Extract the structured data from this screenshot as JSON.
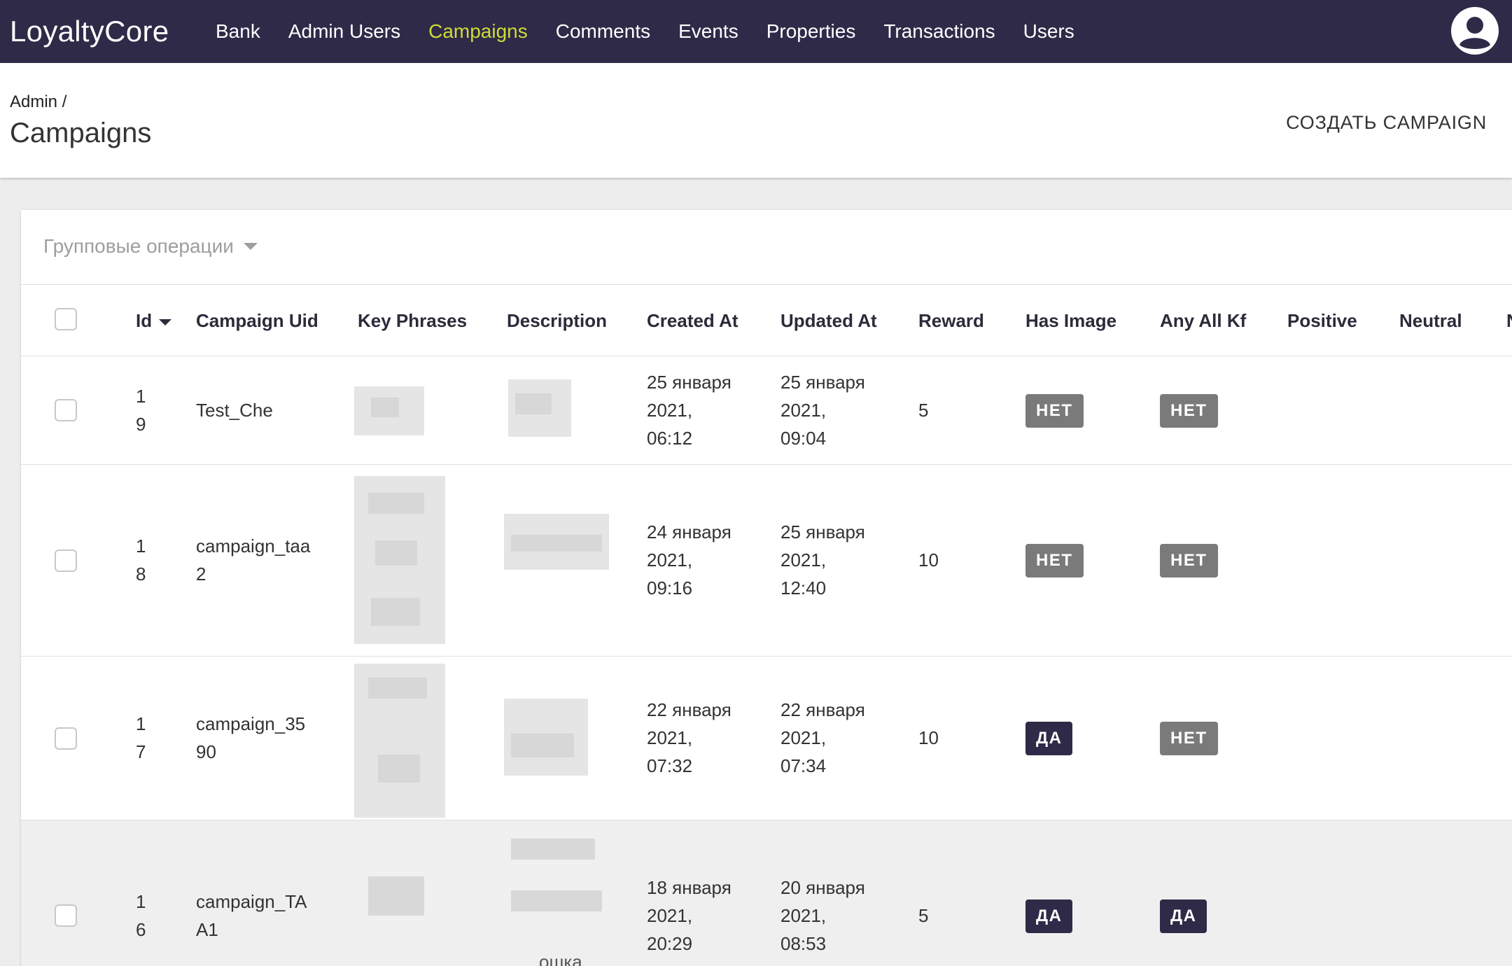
{
  "app": {
    "brand": "LoyaltyCore",
    "nav": [
      {
        "label": "Bank",
        "active": false
      },
      {
        "label": "Admin Users",
        "active": false
      },
      {
        "label": "Campaigns",
        "active": true
      },
      {
        "label": "Comments",
        "active": false
      },
      {
        "label": "Events",
        "active": false
      },
      {
        "label": "Properties",
        "active": false
      },
      {
        "label": "Transactions",
        "active": false
      },
      {
        "label": "Users",
        "active": false
      }
    ],
    "account_icon": "account-circle-icon",
    "colors": {
      "appbar": "#2e2a48",
      "active_nav": "#cddc39",
      "badge_no": "#7a7a7a",
      "badge_yes": "#2e2a48"
    }
  },
  "header": {
    "breadcrumb": "Admin /",
    "title": "Campaigns",
    "create_label": "СОЗДАТЬ CAMPAIGN"
  },
  "bulk": {
    "label": "Групповые операции",
    "icon": "caret-down-icon"
  },
  "table": {
    "columns": [
      "Id",
      "Campaign Uid",
      "Key Phrases",
      "Description",
      "Created At",
      "Updated At",
      "Reward",
      "Has Image",
      "Any All Kf",
      "Positive",
      "Neutral",
      "N"
    ],
    "sort_icon": "sort-down-icon",
    "rows": [
      {
        "id_1": "1",
        "id_2": "9",
        "uid_1": "Test_Che",
        "uid_2": "",
        "created_1": "25 января",
        "created_2": "2021,",
        "created_3": "06:12",
        "updated_1": "25 января",
        "updated_2": "2021,",
        "updated_3": "09:04",
        "reward": "5",
        "has_image": "НЕТ",
        "any_all_kf": "НЕТ"
      },
      {
        "id_1": "1",
        "id_2": "8",
        "uid_1": "campaign_taa",
        "uid_2": "2",
        "created_1": "24 января",
        "created_2": "2021,",
        "created_3": "09:16",
        "updated_1": "25 января",
        "updated_2": "2021,",
        "updated_3": "12:40",
        "reward": "10",
        "has_image": "НЕТ",
        "any_all_kf": "НЕТ"
      },
      {
        "id_1": "1",
        "id_2": "7",
        "uid_1": "campaign_35",
        "uid_2": "90",
        "created_1": "22 января",
        "created_2": "2021,",
        "created_3": "07:32",
        "updated_1": "22 января",
        "updated_2": "2021,",
        "updated_3": "07:34",
        "reward": "10",
        "has_image": "ДА",
        "any_all_kf": "НЕТ"
      },
      {
        "id_1": "1",
        "id_2": "6",
        "uid_1": "campaign_TA",
        "uid_2": "A1",
        "created_1": "18 января",
        "created_2": "2021,",
        "created_3": "20:29",
        "updated_1": "20 января",
        "updated_2": "2021,",
        "updated_3": "08:53",
        "reward": "5",
        "has_image": "ДА",
        "any_all_kf": "ДА",
        "description_fragment": "ошка"
      }
    ]
  }
}
